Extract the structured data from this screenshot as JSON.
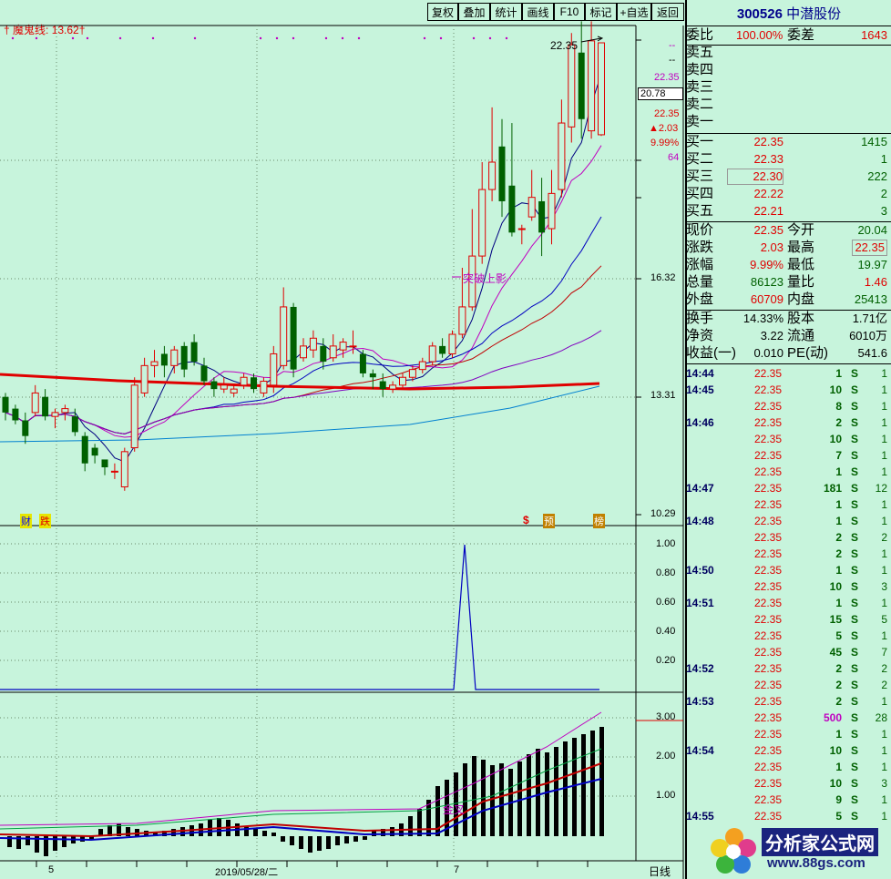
{
  "toolbar": [
    "复权",
    "叠加",
    "统计",
    "画线",
    "F10",
    "标记",
    "+自选",
    "返回"
  ],
  "indicator_label": "魔鬼线: 13.62",
  "indicator_prefix": "†",
  "indicator_suffix": "†",
  "price_axis": [
    "16.32",
    "13.31",
    "10.29"
  ],
  "sub_axis": [
    "1.00",
    "0.80",
    "0.60",
    "0.40",
    "0.20"
  ],
  "macd_axis": [
    "3.00",
    "2.00",
    "1.00"
  ],
  "peak_label": "22.35",
  "breakout_label": "突破上影",
  "golden_cross_label": "金叉",
  "event_marks": [
    "财",
    "跌",
    "$",
    "预",
    "榜"
  ],
  "x_labels": [
    "5",
    "2019/05/28/二",
    "7"
  ],
  "period": "日线",
  "right_labels": {
    "dash1": "--",
    "dash2": "--",
    "p1": "22.35",
    "box": "20.78",
    "p2": "22.35",
    "chg": "▲2.03",
    "pct": "9.99%",
    "vol": "64"
  },
  "stock": {
    "code": "300526",
    "name": "中潜股份"
  },
  "weibi": {
    "label": "委比",
    "value": "100.00%",
    "label2": "委差",
    "value2": "1643"
  },
  "sell": [
    {
      "label": "卖五",
      "price": "",
      "vol": ""
    },
    {
      "label": "卖四",
      "price": "",
      "vol": ""
    },
    {
      "label": "卖三",
      "price": "",
      "vol": ""
    },
    {
      "label": "卖二",
      "price": "",
      "vol": ""
    },
    {
      "label": "卖一",
      "price": "",
      "vol": ""
    }
  ],
  "buy": [
    {
      "label": "买一",
      "price": "22.35",
      "vol": "1415"
    },
    {
      "label": "买二",
      "price": "22.33",
      "vol": "1"
    },
    {
      "label": "买三",
      "price": "22.30",
      "vol": "222"
    },
    {
      "label": "买四",
      "price": "22.22",
      "vol": "2"
    },
    {
      "label": "买五",
      "price": "22.21",
      "vol": "3"
    }
  ],
  "quote": [
    {
      "l1": "现价",
      "v1": "22.35",
      "l2": "今开",
      "v2": "20.04",
      "c1": "#e00000",
      "c2": "#006000"
    },
    {
      "l1": "涨跌",
      "v1": "2.03",
      "l2": "最高",
      "v2": "22.35",
      "c1": "#e00000",
      "c2": "#e00000"
    },
    {
      "l1": "涨幅",
      "v1": "9.99%",
      "l2": "最低",
      "v2": "19.97",
      "c1": "#e00000",
      "c2": "#006000"
    },
    {
      "l1": "总量",
      "v1": "86123",
      "l2": "量比",
      "v2": "1.46",
      "c1": "#006000",
      "c2": "#e00000"
    },
    {
      "l1": "外盘",
      "v1": "60709",
      "l2": "内盘",
      "v2": "25413",
      "c1": "#e00000",
      "c2": "#006000"
    }
  ],
  "fund": [
    {
      "l1": "换手",
      "v1": "14.33%",
      "l2": "股本",
      "v2": "1.71亿"
    },
    {
      "l1": "净资",
      "v1": "3.22",
      "l2": "流通",
      "v2": "6010万"
    },
    {
      "l1": "收益(一)",
      "v1": "0.010",
      "l2": "PE(动)",
      "v2": "541.6"
    }
  ],
  "ticks": [
    {
      "t": "14:44",
      "p": "22.35",
      "v": "1",
      "s": "S",
      "n": "1"
    },
    {
      "t": "14:45",
      "p": "22.35",
      "v": "10",
      "s": "S",
      "n": "1"
    },
    {
      "t": "",
      "p": "22.35",
      "v": "8",
      "s": "S",
      "n": "1"
    },
    {
      "t": "14:46",
      "p": "22.35",
      "v": "2",
      "s": "S",
      "n": "1"
    },
    {
      "t": "",
      "p": "22.35",
      "v": "10",
      "s": "S",
      "n": "1"
    },
    {
      "t": "",
      "p": "22.35",
      "v": "7",
      "s": "S",
      "n": "1"
    },
    {
      "t": "",
      "p": "22.35",
      "v": "1",
      "s": "S",
      "n": "1"
    },
    {
      "t": "14:47",
      "p": "22.35",
      "v": "181",
      "s": "S",
      "n": "12"
    },
    {
      "t": "",
      "p": "22.35",
      "v": "1",
      "s": "S",
      "n": "1"
    },
    {
      "t": "14:48",
      "p": "22.35",
      "v": "1",
      "s": "S",
      "n": "1"
    },
    {
      "t": "",
      "p": "22.35",
      "v": "2",
      "s": "S",
      "n": "2"
    },
    {
      "t": "",
      "p": "22.35",
      "v": "2",
      "s": "S",
      "n": "1"
    },
    {
      "t": "14:50",
      "p": "22.35",
      "v": "1",
      "s": "S",
      "n": "1"
    },
    {
      "t": "",
      "p": "22.35",
      "v": "10",
      "s": "S",
      "n": "3"
    },
    {
      "t": "14:51",
      "p": "22.35",
      "v": "1",
      "s": "S",
      "n": "1"
    },
    {
      "t": "",
      "p": "22.35",
      "v": "15",
      "s": "S",
      "n": "5"
    },
    {
      "t": "",
      "p": "22.35",
      "v": "5",
      "s": "S",
      "n": "1"
    },
    {
      "t": "",
      "p": "22.35",
      "v": "45",
      "s": "S",
      "n": "7"
    },
    {
      "t": "14:52",
      "p": "22.35",
      "v": "2",
      "s": "S",
      "n": "2"
    },
    {
      "t": "",
      "p": "22.35",
      "v": "2",
      "s": "S",
      "n": "2"
    },
    {
      "t": "14:53",
      "p": "22.35",
      "v": "2",
      "s": "S",
      "n": "1"
    },
    {
      "t": "",
      "p": "22.35",
      "v": "500",
      "s": "S",
      "n": "28"
    },
    {
      "t": "",
      "p": "22.35",
      "v": "1",
      "s": "S",
      "n": "1"
    },
    {
      "t": "14:54",
      "p": "22.35",
      "v": "10",
      "s": "S",
      "n": "1"
    },
    {
      "t": "",
      "p": "22.35",
      "v": "1",
      "s": "S",
      "n": "1"
    },
    {
      "t": "",
      "p": "22.35",
      "v": "10",
      "s": "S",
      "n": "3"
    },
    {
      "t": "",
      "p": "22.35",
      "v": "9",
      "s": "S",
      "n": "1"
    },
    {
      "t": "14:55",
      "p": "22.35",
      "v": "5",
      "s": "S",
      "n": "1"
    }
  ],
  "watermark": {
    "text": "分析家公式网",
    "url": "www.88gs.com"
  },
  "colors": {
    "bg": "#c7f4dc",
    "up": "#e00000",
    "down": "#006000",
    "blue": "#0000c0",
    "magenta": "#c000c0",
    "wm": "#1a237e"
  },
  "chart_data": {
    "type": "candlestick",
    "price_ticks": [
      16.32,
      13.31,
      10.29
    ],
    "candles": [
      [
        13.3,
        12.9,
        13.4,
        12.7
      ],
      [
        13.0,
        12.7,
        13.1,
        12.6
      ],
      [
        12.7,
        12.3,
        12.9,
        12.1
      ],
      [
        12.9,
        13.4,
        13.6,
        12.8
      ],
      [
        13.3,
        12.8,
        13.5,
        12.7
      ],
      [
        12.8,
        12.9,
        13.0,
        12.5
      ],
      [
        12.9,
        13.0,
        13.1,
        12.7
      ],
      [
        12.8,
        12.4,
        13.0,
        12.3
      ],
      [
        12.3,
        11.6,
        12.4,
        11.4
      ],
      [
        12.0,
        11.8,
        12.1,
        11.6
      ],
      [
        11.7,
        11.5,
        11.7,
        11.3
      ],
      [
        11.4,
        11.4,
        11.6,
        11.2
      ],
      [
        11.0,
        11.9,
        12.0,
        10.9
      ],
      [
        12.0,
        13.6,
        13.8,
        11.9
      ],
      [
        13.4,
        14.1,
        14.3,
        13.3
      ],
      [
        14.1,
        14.2,
        14.5,
        13.8
      ],
      [
        14.4,
        14.1,
        14.6,
        13.8
      ],
      [
        14.1,
        14.5,
        14.6,
        13.9
      ],
      [
        14.6,
        14.0,
        14.7,
        13.8
      ],
      [
        14.7,
        14.2,
        14.9,
        14.1
      ],
      [
        14.1,
        13.7,
        14.3,
        13.6
      ],
      [
        13.7,
        13.5,
        13.8,
        13.3
      ],
      [
        13.5,
        13.6,
        13.8,
        13.4
      ],
      [
        13.4,
        13.5,
        13.6,
        13.3
      ],
      [
        13.6,
        13.8,
        13.9,
        13.5
      ],
      [
        13.8,
        13.5,
        13.9,
        13.4
      ],
      [
        13.4,
        13.7,
        13.8,
        13.3
      ],
      [
        13.6,
        14.4,
        14.6,
        13.4
      ],
      [
        14.1,
        15.6,
        16.1,
        14.0
      ],
      [
        15.6,
        14.0,
        15.7,
        13.8
      ],
      [
        14.3,
        14.6,
        14.8,
        14.2
      ],
      [
        14.5,
        14.8,
        15.0,
        14.3
      ],
      [
        14.6,
        14.2,
        14.8,
        14.0
      ],
      [
        14.3,
        14.6,
        14.9,
        14.2
      ],
      [
        14.5,
        14.7,
        14.8,
        14.3
      ],
      [
        14.6,
        14.6,
        15.0,
        14.4
      ],
      [
        14.4,
        13.9,
        14.5,
        13.8
      ],
      [
        13.9,
        13.8,
        14.0,
        13.5
      ],
      [
        13.7,
        13.5,
        13.9,
        13.3
      ],
      [
        13.5,
        13.6,
        13.7,
        13.4
      ],
      [
        13.6,
        13.8,
        13.9,
        13.5
      ],
      [
        13.8,
        14.0,
        14.1,
        13.7
      ],
      [
        14.0,
        14.2,
        14.3,
        13.9
      ],
      [
        14.2,
        14.6,
        14.7,
        14.1
      ],
      [
        14.6,
        14.4,
        14.8,
        14.3
      ],
      [
        14.4,
        14.9,
        15.0,
        14.3
      ],
      [
        14.9,
        15.6,
        16.6,
        14.8
      ],
      [
        15.6,
        16.9,
        18.1,
        15.5
      ],
      [
        16.9,
        18.6,
        19.3,
        16.7
      ],
      [
        18.6,
        19.3,
        20.7,
        18.3
      ],
      [
        19.7,
        18.3,
        20.4,
        17.9
      ],
      [
        18.7,
        17.5,
        20.3,
        17.4
      ],
      [
        17.6,
        17.6,
        17.7,
        17.2
      ],
      [
        17.9,
        18.4,
        19.1,
        17.8
      ],
      [
        18.3,
        17.5,
        18.9,
        16.9
      ],
      [
        17.6,
        18.5,
        19.1,
        17.2
      ],
      [
        18.6,
        20.3,
        20.9,
        18.4
      ],
      [
        20.2,
        22.3,
        22.6,
        19.8
      ],
      [
        22.1,
        20.4,
        22.9,
        19.9
      ],
      [
        20.1,
        22.4,
        22.9,
        19.9
      ],
      [
        20.0,
        22.35,
        22.35,
        19.97
      ]
    ]
  }
}
